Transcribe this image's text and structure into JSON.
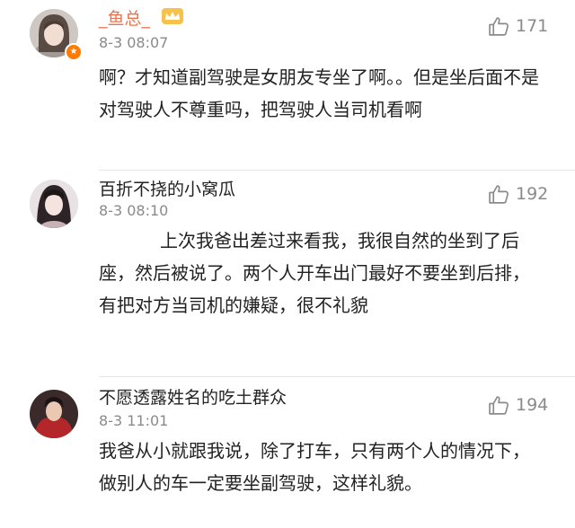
{
  "comments": [
    {
      "username": "_鱼总_",
      "time": "8-3 08:07",
      "likes": "171",
      "badge": "vip-crown",
      "text": "啊？才知道副驾驶是女朋友专坐了啊。。但是坐后面不是对驾驶人不尊重吗，把驾驶人当司机看啊"
    },
    {
      "username": "百折不挠的小窝瓜",
      "time": "8-3 08:10",
      "likes": "192",
      "text": "上次我爸出差过来看我，我很自然的坐到了后座，然后被说了。两个人开车出门最好不要坐到后排，有把对方当司机的嫌疑，很不礼貌"
    },
    {
      "username": "不愿透露姓名的吃土群众",
      "time": "8-3 11:01",
      "likes": "194",
      "text": "我爸从小就跟我说，除了打车，只有两个人的情况下，做别人的车一定要坐副驾驶，这样礼貌。"
    }
  ],
  "colors": {
    "vip_name": "#eb7350",
    "meta": "#8a8a8a",
    "badge": "#ff7a00"
  }
}
